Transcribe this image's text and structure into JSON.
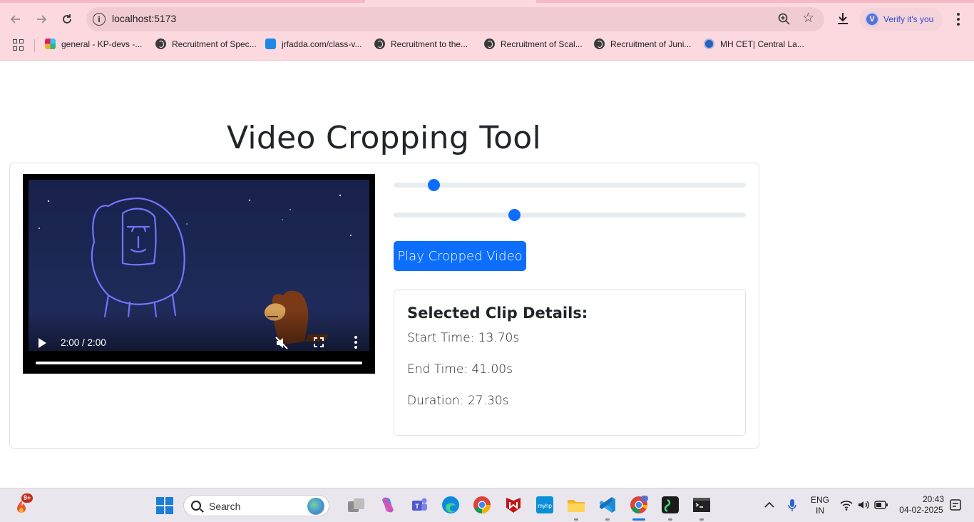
{
  "browser": {
    "url": "localhost:5173",
    "profile_initial": "V",
    "profile_label": "Verify it's you",
    "bookmarks": [
      {
        "label": "general - KP-devs -...",
        "icon": "slack-icon"
      },
      {
        "label": "Recruitment of Spec...",
        "icon": "globe-icon"
      },
      {
        "label": "jrfadda.com/class-v...",
        "icon": "jrfadda-icon"
      },
      {
        "label": "Recruitment to the...",
        "icon": "globe-icon"
      },
      {
        "label": "Recruitment of Scal...",
        "icon": "globe-icon"
      },
      {
        "label": "Recruitment of Juni...",
        "icon": "globe-icon"
      },
      {
        "label": "MH CET| Central La...",
        "icon": "mhcet-icon"
      }
    ]
  },
  "page": {
    "title": "Video Cropping Tool",
    "video": {
      "time": "2:00 / 2:00",
      "progress": 1.0
    },
    "start_slider": {
      "value": 13.7,
      "max": 120
    },
    "end_slider": {
      "value": 41.0,
      "max": 120
    },
    "play_button": "Play Cropped Video",
    "details": {
      "heading": "Selected Clip Details:",
      "start": "Start Time: 13.70s",
      "end": "End Time: 41.00s",
      "duration": "Duration: 27.30s"
    },
    "accent": "#0d6efd"
  },
  "taskbar": {
    "widget_badge": "9+",
    "search_placeholder": "Search",
    "lang_line1": "ENG",
    "lang_line2": "IN",
    "time": "20:43",
    "date": "04-02-2025"
  }
}
